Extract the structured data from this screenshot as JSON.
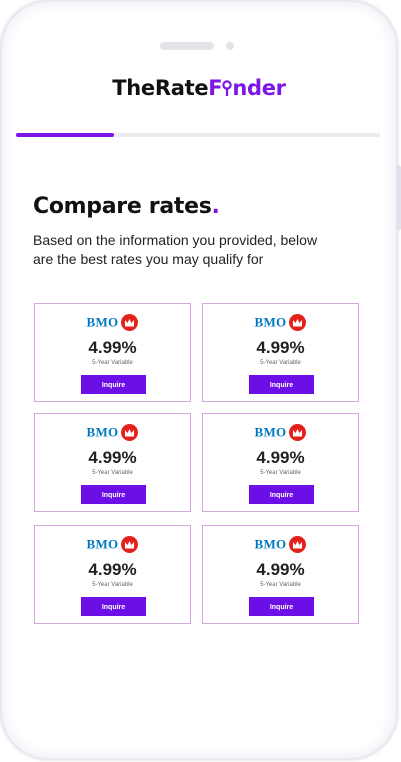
{
  "header": {
    "logo_part1": "TheRate",
    "logo_part2": "F",
    "logo_part3": "nder",
    "accent_color": "#7b16e6"
  },
  "progress": {
    "value_percent": 27
  },
  "main": {
    "title": "Compare rates",
    "title_dot": ".",
    "subtitle": "Based on the information you provided, below are the best rates you may qualify for"
  },
  "rates": [
    {
      "bank": "BMO",
      "rate": "4.99%",
      "term": "5-Year Variable",
      "button": "Inquire"
    },
    {
      "bank": "BMO",
      "rate": "4.99%",
      "term": "5-Year Variable",
      "button": "Inquire"
    },
    {
      "bank": "BMO",
      "rate": "4.99%",
      "term": "5-Year Variable",
      "button": "Inquire"
    },
    {
      "bank": "BMO",
      "rate": "4.99%",
      "term": "5-Year Variable",
      "button": "Inquire"
    },
    {
      "bank": "BMO",
      "rate": "4.99%",
      "term": "5-Year Variable",
      "button": "Inquire"
    },
    {
      "bank": "BMO",
      "rate": "4.99%",
      "term": "5-Year Variable",
      "button": "Inquire"
    }
  ]
}
